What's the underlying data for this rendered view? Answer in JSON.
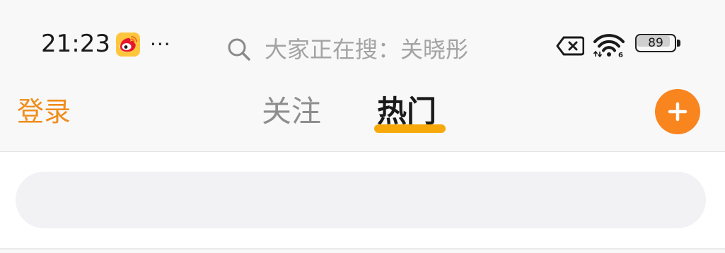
{
  "status_bar": {
    "time": "21:23",
    "notification_app_icon": "weibo-icon",
    "more_indicator": "···",
    "sim_icon": "no-sim-icon",
    "wifi_icon": "wifi-6-icon",
    "battery_level": "89",
    "battery_fraction": 0.89
  },
  "header": {
    "login_label": "登录",
    "tabs": [
      {
        "label": "关注",
        "active": false
      },
      {
        "label": "热门",
        "active": true
      }
    ],
    "add_icon": "plus-icon"
  },
  "search": {
    "icon": "search-icon",
    "placeholder": "大家正在搜：关晓彤"
  },
  "colors": {
    "accent_orange": "#f9851f",
    "login_orange": "#f08d1c",
    "tab_indicator": "#f7a90c",
    "inactive_tab": "#8e8e8e",
    "active_tab": "#1a1a1a",
    "placeholder": "#a3a3a3"
  }
}
